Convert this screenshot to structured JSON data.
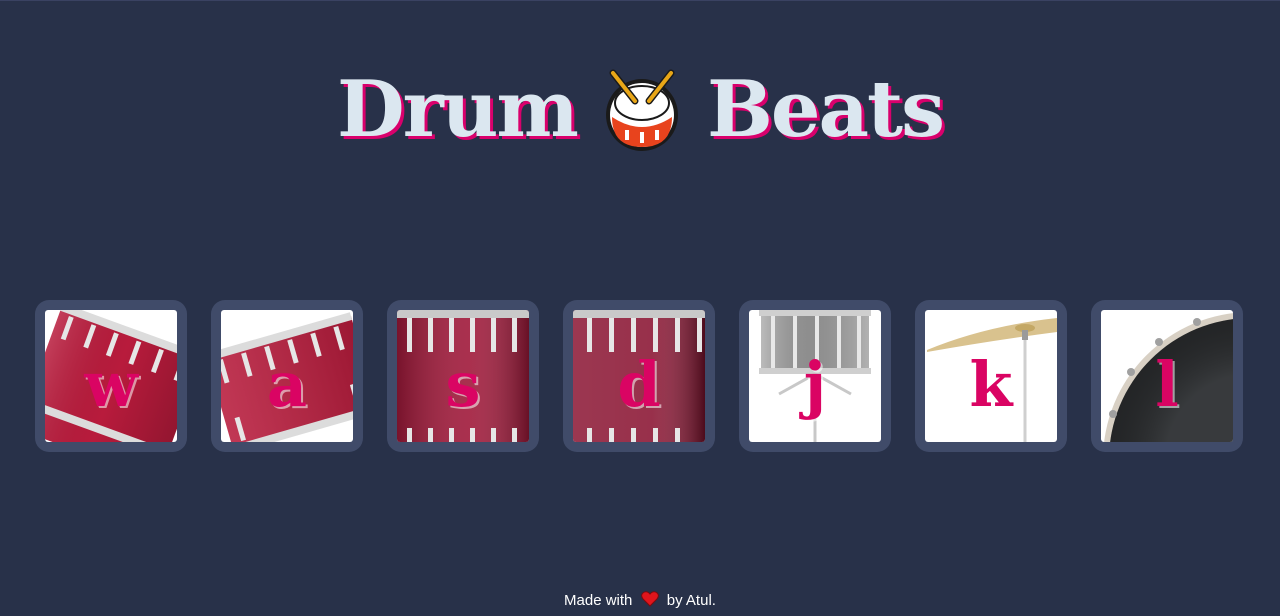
{
  "title": {
    "word1": "Drum",
    "word2": "Beats",
    "emoji_icon": "drum-icon"
  },
  "keys": [
    {
      "letter": "w",
      "instrument": "tom-drum-icon"
    },
    {
      "letter": "a",
      "instrument": "tom-drum-icon"
    },
    {
      "letter": "s",
      "instrument": "bass-drum-icon"
    },
    {
      "letter": "d",
      "instrument": "bass-drum-icon"
    },
    {
      "letter": "j",
      "instrument": "snare-drum-icon"
    },
    {
      "letter": "k",
      "instrument": "cymbal-icon"
    },
    {
      "letter": "l",
      "instrument": "kick-drum-icon"
    }
  ],
  "footer": {
    "made_with": "Made with",
    "by": "by Atul.",
    "heart_icon": "heart-icon"
  },
  "colors": {
    "background": "#283149",
    "key_frame": "#404b69",
    "accent": "#da0463",
    "title_text": "#dbe7f0"
  }
}
